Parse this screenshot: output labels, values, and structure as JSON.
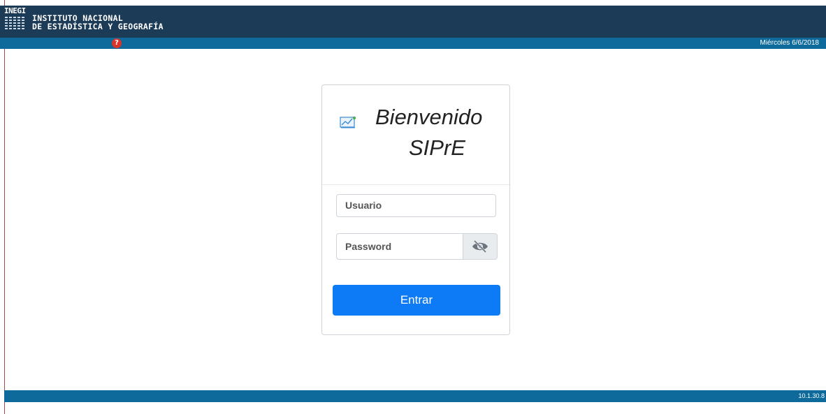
{
  "header": {
    "logo_word": "INEGI",
    "org_line1": "INSTITUTO NACIONAL",
    "org_line2": "DE ESTADÍSTICA Y GEOGRAFÍA",
    "help_symbol": "?",
    "date": "Miércoles 6/6/2018"
  },
  "login": {
    "icon": "chart-monitor-icon",
    "title": "Bienvenido",
    "subtitle": "SIPrE",
    "username_placeholder": "Usuario",
    "password_placeholder": "Password",
    "toggle_icon": "eye-slash-icon",
    "submit_label": "Entrar"
  },
  "footer": {
    "version": "10.1.30.8"
  },
  "colors": {
    "header_bg": "#1c3b57",
    "bar_bg": "#0d6a9a",
    "primary_button": "#0d7bf5",
    "help_icon": "#d9352c"
  }
}
